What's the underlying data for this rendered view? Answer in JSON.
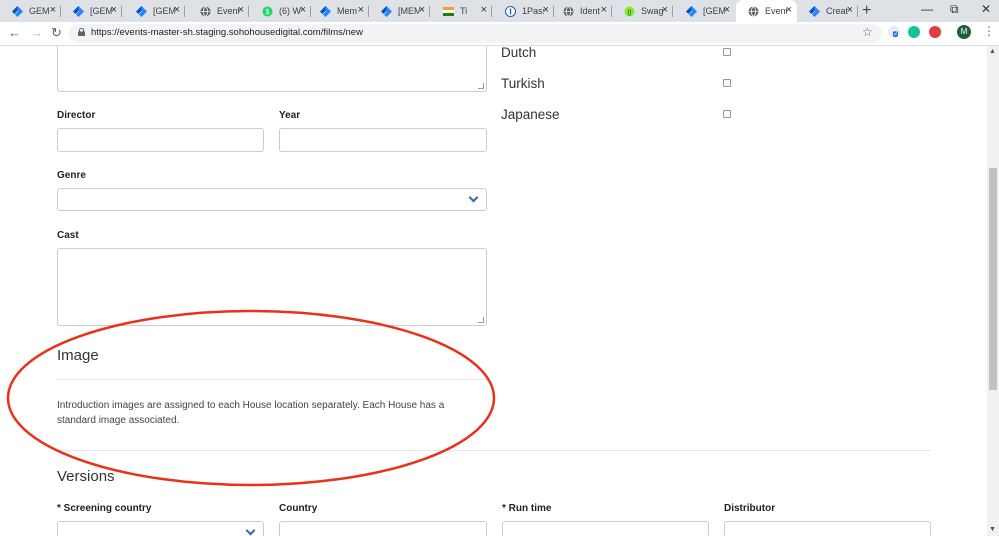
{
  "browser": {
    "tabs": [
      {
        "title": "GEM",
        "icon": "jira-icon"
      },
      {
        "title": "[GEM",
        "icon": "jira-icon"
      },
      {
        "title": "[GEM",
        "icon": "jira-icon"
      },
      {
        "title": "Event",
        "icon": "globe-icon"
      },
      {
        "title": "(6) W",
        "icon": "whatsapp-icon"
      },
      {
        "title": "Mem",
        "icon": "jira-icon"
      },
      {
        "title": "[MEM",
        "icon": "jira-icon"
      },
      {
        "title": "Ti",
        "icon": "india-flag-icon"
      },
      {
        "title": "1Pass",
        "icon": "1password-icon"
      },
      {
        "title": "Ident",
        "icon": "globe-icon"
      },
      {
        "title": "Swag",
        "icon": "swagger-icon"
      },
      {
        "title": "[GEM",
        "icon": "jira-icon"
      },
      {
        "title": "Event",
        "icon": "globe-icon",
        "active": true
      },
      {
        "title": "Creat",
        "icon": "jira-icon"
      }
    ],
    "new_tab": "+",
    "url": "https://events-master-sh.staging.sohohousedigital.com/films/new",
    "ext_badge": "2",
    "avatar_letter": "M"
  },
  "form": {
    "director_label": "Director",
    "year_label": "Year",
    "genre_label": "Genre",
    "cast_label": "Cast"
  },
  "languages": [
    "Dutch",
    "Turkish",
    "Japanese"
  ],
  "image_section": {
    "title": "Image",
    "description": "Introduction images are assigned to each House location separately. Each House has a standard image associated."
  },
  "versions_section": {
    "title": "Versions",
    "screening_country_label": "* Screening country",
    "country_label": "Country",
    "run_time_label": "* Run time",
    "distributor_label": "Distributor"
  },
  "colors": {
    "annotation_ellipse": "#e8321a",
    "select_chevron": "#2f6bb3"
  }
}
